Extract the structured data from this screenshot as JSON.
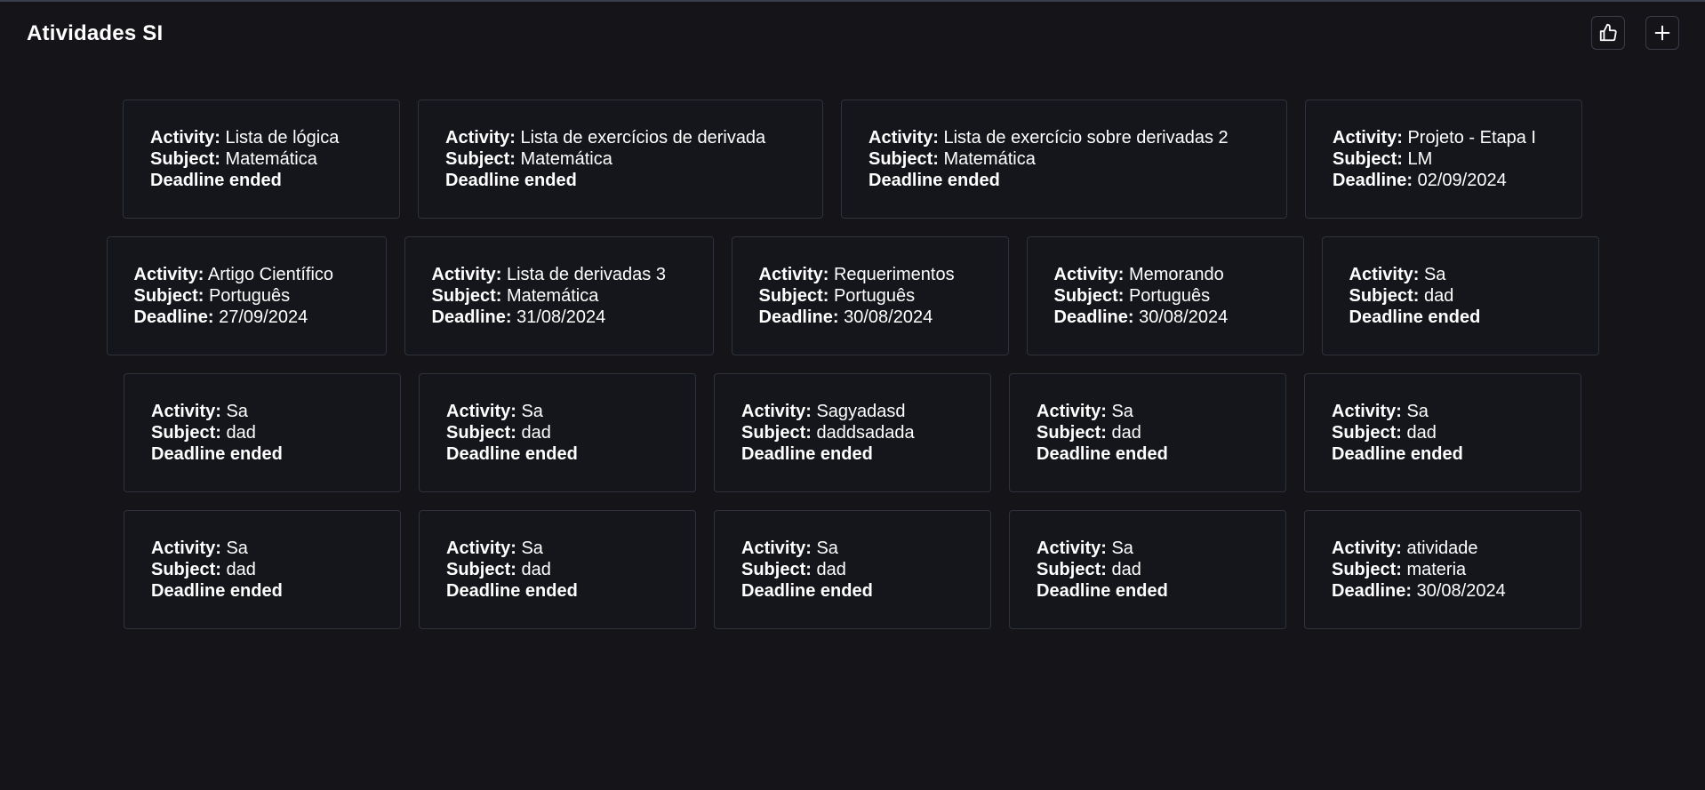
{
  "header": {
    "title": "Atividades SI",
    "like_icon": "thumbs-up-icon",
    "add_icon": "plus-icon"
  },
  "labels": {
    "activity": "Activity:",
    "subject": "Subject:",
    "deadline": "Deadline:"
  },
  "rows": [
    [
      {
        "activity": "Lista de lógica",
        "subject": "Matemática",
        "deadline_ended": "Deadline ended"
      },
      {
        "activity": "Lista de exercícios de derivada",
        "subject": "Matemática",
        "deadline_ended": "Deadline ended"
      },
      {
        "activity": "Lista de exercício sobre derivadas 2",
        "subject": "Matemática",
        "deadline_ended": "Deadline ended"
      },
      {
        "activity": "Projeto - Etapa I",
        "subject": "LM",
        "deadline": "02/09/2024"
      }
    ],
    [
      {
        "activity": "Artigo Científico",
        "subject": "Português",
        "deadline": "27/09/2024"
      },
      {
        "activity": "Lista de derivadas 3",
        "subject": "Matemática",
        "deadline": "31/08/2024"
      },
      {
        "activity": "Requerimentos",
        "subject": "Português",
        "deadline": "30/08/2024"
      },
      {
        "activity": "Memorando",
        "subject": "Português",
        "deadline": "30/08/2024"
      },
      {
        "activity": "Sa",
        "subject": "dad",
        "deadline_ended": "Deadline ended"
      }
    ],
    [
      {
        "activity": "Sa",
        "subject": "dad",
        "deadline_ended": "Deadline ended"
      },
      {
        "activity": "Sa",
        "subject": "dad",
        "deadline_ended": "Deadline ended"
      },
      {
        "activity": "Sagyadasd",
        "subject": "daddsadada",
        "deadline_ended": "Deadline ended"
      },
      {
        "activity": "Sa",
        "subject": "dad",
        "deadline_ended": "Deadline ended"
      },
      {
        "activity": "Sa",
        "subject": "dad",
        "deadline_ended": "Deadline ended"
      }
    ],
    [
      {
        "activity": "Sa",
        "subject": "dad",
        "deadline_ended": "Deadline ended"
      },
      {
        "activity": "Sa",
        "subject": "dad",
        "deadline_ended": "Deadline ended"
      },
      {
        "activity": "Sa",
        "subject": "dad",
        "deadline_ended": "Deadline ended"
      },
      {
        "activity": "Sa",
        "subject": "dad",
        "deadline_ended": "Deadline ended"
      },
      {
        "activity": "atividade",
        "subject": "materia",
        "deadline": "30/08/2024"
      }
    ]
  ]
}
